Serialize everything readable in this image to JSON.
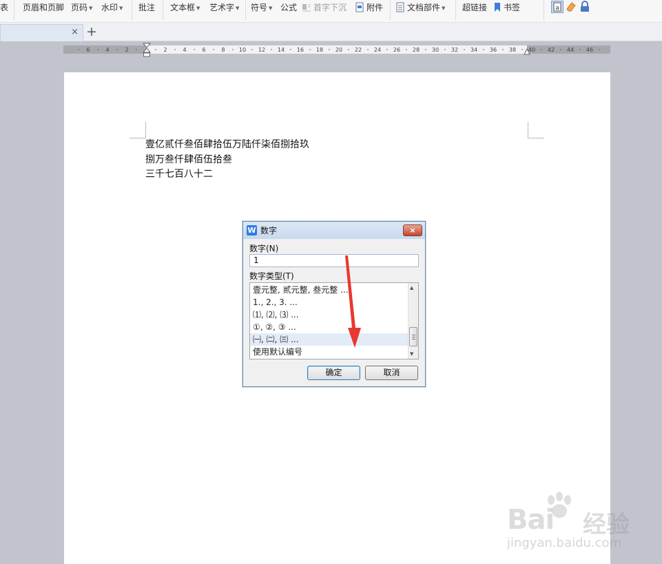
{
  "ribbon": {
    "items": [
      {
        "label": "表",
        "dropdown": false
      },
      {
        "label": "页眉和页脚",
        "dropdown": false
      },
      {
        "label": "页码",
        "dropdown": true
      },
      {
        "label": "水印",
        "dropdown": true
      },
      {
        "label": "批注",
        "dropdown": false
      },
      {
        "label": "文本框",
        "dropdown": true
      },
      {
        "label": "艺术字",
        "dropdown": true
      },
      {
        "label": "符号",
        "dropdown": true
      },
      {
        "label": "公式",
        "dropdown": false
      },
      {
        "label": "首字下沉",
        "dropdown": false,
        "disabled": true
      },
      {
        "label": "附件",
        "dropdown": false
      },
      {
        "label": "文档部件",
        "dropdown": true
      },
      {
        "label": "超链接",
        "dropdown": false
      },
      {
        "label": "书签",
        "dropdown": false
      }
    ]
  },
  "tabs": {
    "close": "×",
    "new": "+"
  },
  "ruler": {
    "left_labels": [
      "6",
      "4",
      "2"
    ],
    "right_labels": [
      "2",
      "4",
      "6",
      "8",
      "10",
      "12",
      "14",
      "16",
      "18",
      "20",
      "22",
      "24",
      "26",
      "28",
      "30",
      "32",
      "34",
      "36",
      "38",
      "40",
      "42",
      "44",
      "46"
    ]
  },
  "document": {
    "lines": [
      "壹亿贰仟叁佰肆拾伍万陆仟柒佰捌拾玖",
      "捌万叁仟肆佰伍拾叁",
      "三千七百八十二"
    ]
  },
  "dialog": {
    "title": "数字",
    "close": "×",
    "logo": "W",
    "number_label": "数字(N)",
    "number_value": "1",
    "type_label": "数字类型(T)",
    "types": [
      "壹元整, 贰元整, 叁元整 ...",
      "1., 2., 3. ...",
      "⑴, ⑵, ⑶ ...",
      "①, ②, ③ ...",
      "㈠, ㈡, ㈢ ...",
      "使用默认编号"
    ],
    "selected_index": 4,
    "ok": "确定",
    "cancel": "取消"
  },
  "watermark": {
    "brand": "Bai",
    "brand_cn": "经验",
    "url": "jingyan.baidu.com"
  },
  "colors": {
    "accent": "#2f7de1",
    "annotation_arrow": "#e8382f",
    "page_bg": "#c1c4cc"
  }
}
